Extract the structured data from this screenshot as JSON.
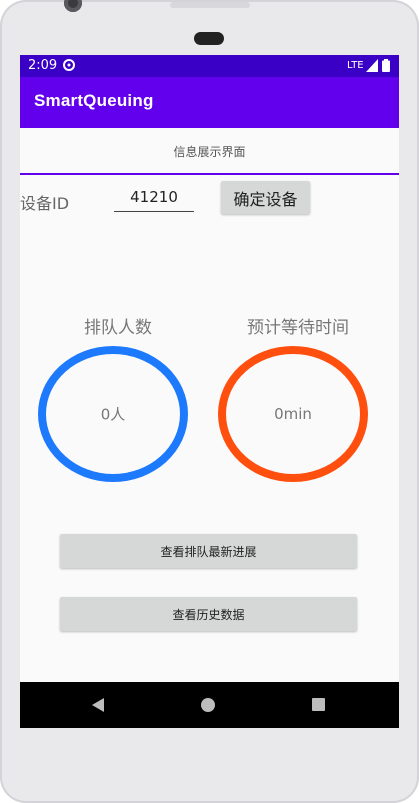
{
  "status_bar": {
    "time": "2:09",
    "network": "LTE",
    "icons": [
      "sync-icon",
      "signal-icon",
      "battery-icon"
    ]
  },
  "app_bar": {
    "title": "SmartQueuing",
    "color": "#6200ee"
  },
  "content": {
    "section_title": "信息展示界面",
    "device": {
      "label": "设备ID",
      "input_value": "41210",
      "confirm_label": "确定设备"
    },
    "metrics": {
      "queue_count_label": "排队人数",
      "queue_count_value": "0人",
      "queue_ring_color": "#1e7afc",
      "wait_time_label": "预计等待时间",
      "wait_time_value": "0min",
      "wait_ring_color": "#ff4f0f"
    },
    "buttons": {
      "latest_progress": "查看排队最新进展",
      "history_data": "查看历史数据"
    }
  },
  "nav_bar": {
    "icons": [
      "back-icon",
      "home-icon",
      "recent-apps-icon"
    ]
  }
}
